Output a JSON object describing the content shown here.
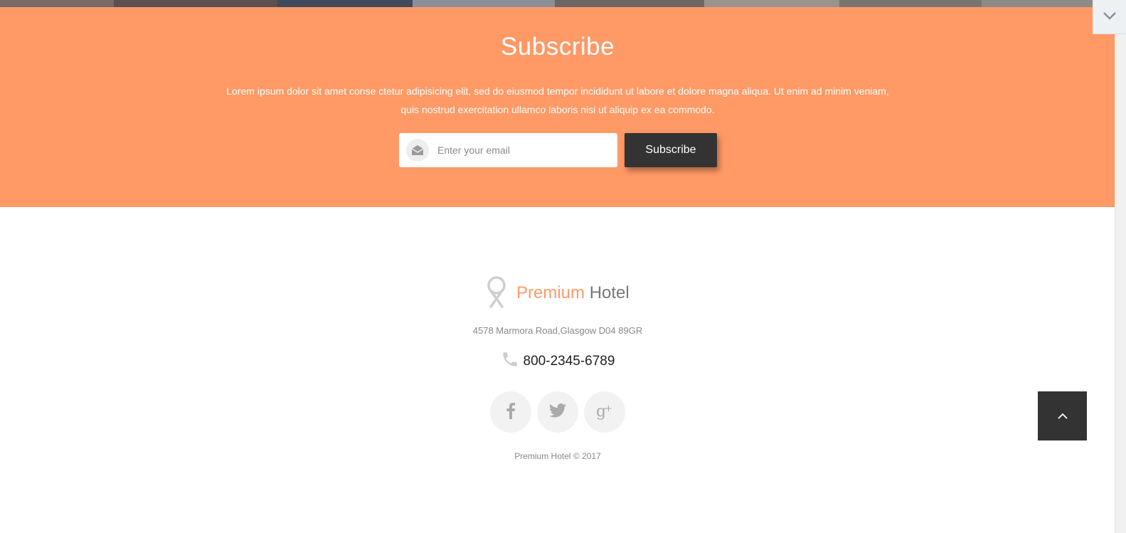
{
  "subscribe": {
    "title": "Subscribe",
    "text_line1": "Lorem ipsum dolor sit amet conse ctetur adipisicing elit, sed do eiusmod tempor incididunt ut labore et dolore magna aliqua. Ut enim ad minim veniam,",
    "text_line2": "quis nostrud exercitation ullamco laboris nisi ut aliquip ex ea commodo.",
    "email_placeholder": "Enter your email",
    "button_label": "Subscribe",
    "background_color": "#ff9966"
  },
  "footer": {
    "brand_accent": "Premium",
    "brand_rest": "Hotel",
    "address": "4578 Marmora Road,Glasgow D04 89GR",
    "phone": "800-2345-6789",
    "socials": [
      "facebook-icon",
      "twitter-icon",
      "google-plus-icon"
    ],
    "copyright": "Premium Hotel © 2017"
  },
  "icons": {
    "email": "envelope-open-icon",
    "phone": "phone-icon",
    "logo": "ribbon-pin-icon",
    "back_to_top": "chevron-up-icon",
    "scroll": "chevron-down-icon"
  }
}
